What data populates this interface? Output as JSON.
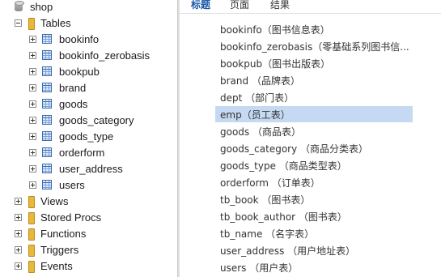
{
  "tree": {
    "database": "shop",
    "tables_folder": "Tables",
    "tables": [
      "bookinfo",
      "bookinfo_zerobasis",
      "bookpub",
      "brand",
      "goods",
      "goods_category",
      "goods_type",
      "orderform",
      "user_address",
      "users"
    ],
    "folders": [
      "Views",
      "Stored Procs",
      "Functions",
      "Triggers",
      "Events"
    ]
  },
  "tabs": [
    "标题",
    "页面",
    "结果"
  ],
  "active_tab": "标题",
  "list": {
    "items": [
      "bookinfo（图书信息表）",
      "bookinfo_zerobasis（零基础系列图书信...",
      "bookpub（图书出版表）",
      "brand （品牌表）",
      "dept （部门表）",
      "emp（员工表）",
      "goods （商品表）",
      "goods_category （商品分类表）",
      "goods_type （商品类型表）",
      "orderform （订单表）",
      "tb_book （图书表）",
      "tb_book_author （图书表）",
      "tb_name （名字表）",
      "user_address （用户地址表）",
      "users （用户表）"
    ],
    "selected": "emp（员工表）"
  },
  "colors": {
    "selection": "#c5d9f3",
    "active_tab": "#1c5aa8",
    "table_icon": "#3d6db3",
    "folder_icon": "#e8b83a"
  }
}
